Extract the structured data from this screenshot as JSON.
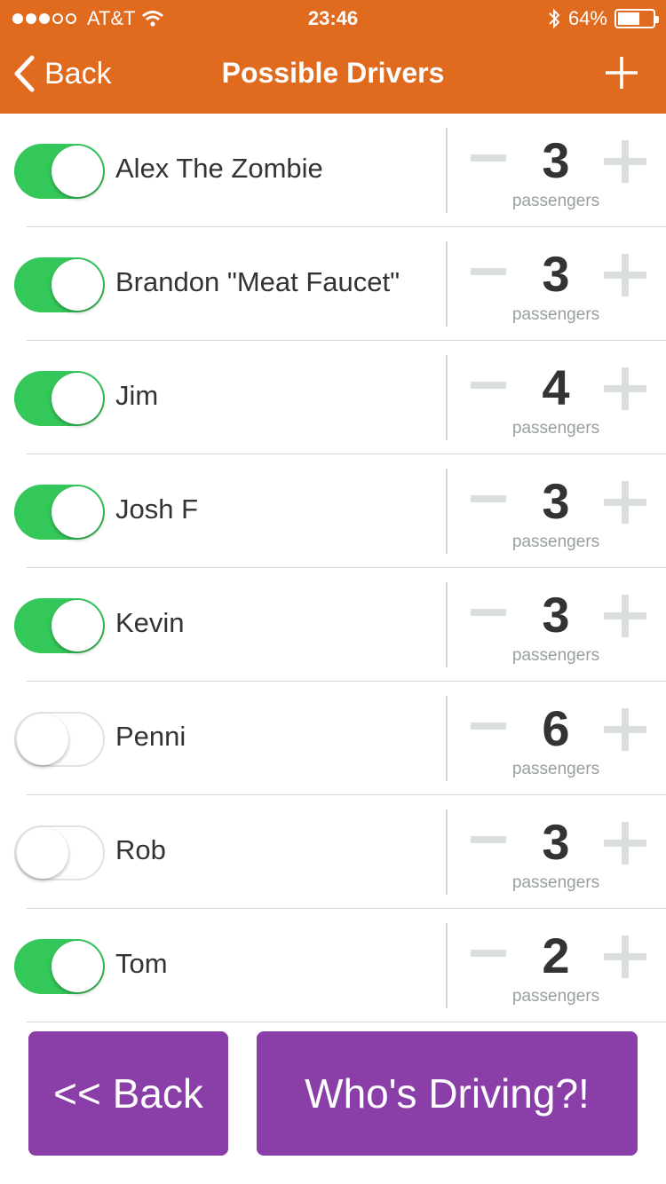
{
  "status_bar": {
    "carrier": "AT&T",
    "time": "23:46",
    "battery": "64%",
    "battery_level": 0.64,
    "signal_bars": 3,
    "signal_total": 5
  },
  "nav": {
    "back_label": "Back",
    "title": "Possible Drivers"
  },
  "colors": {
    "nav_bg": "#e06a1e",
    "toggle_on": "#34c759",
    "button_bg": "#8a3ea8"
  },
  "drivers": [
    {
      "name": "Alex The Zombie",
      "enabled": true,
      "passengers": "3",
      "passengers_label": "passengers"
    },
    {
      "name": "Brandon \"Meat Faucet\"",
      "enabled": true,
      "passengers": "3",
      "passengers_label": "passengers"
    },
    {
      "name": "Jim",
      "enabled": true,
      "passengers": "4",
      "passengers_label": "passengers"
    },
    {
      "name": "Josh F",
      "enabled": true,
      "passengers": "3",
      "passengers_label": "passengers"
    },
    {
      "name": "Kevin",
      "enabled": true,
      "passengers": "3",
      "passengers_label": "passengers"
    },
    {
      "name": "Penni",
      "enabled": false,
      "passengers": "6",
      "passengers_label": "passengers"
    },
    {
      "name": "Rob",
      "enabled": false,
      "passengers": "3",
      "passengers_label": "passengers"
    },
    {
      "name": "Tom",
      "enabled": true,
      "passengers": "2",
      "passengers_label": "passengers"
    }
  ],
  "footer": {
    "back_label": "<< Back",
    "drive_label": "Who's Driving?!"
  }
}
